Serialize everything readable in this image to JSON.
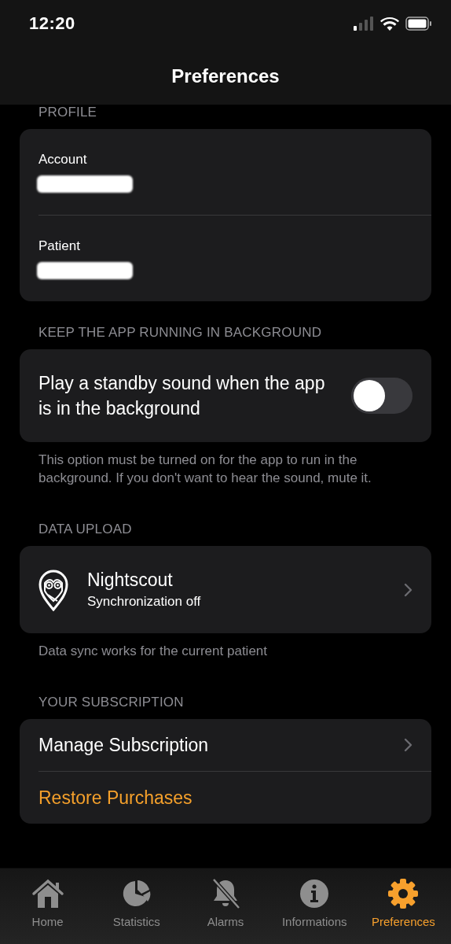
{
  "status_bar": {
    "time": "12:20"
  },
  "nav": {
    "title": "Preferences"
  },
  "sections": [
    {
      "header": "PROFILE",
      "rows": [
        {
          "kind": "field",
          "label": "Account",
          "redacted": true
        },
        {
          "kind": "field",
          "label": "Patient",
          "redacted": true
        }
      ]
    },
    {
      "header": "KEEP THE APP RUNNING IN BACKGROUND",
      "rows": [
        {
          "kind": "toggle",
          "label": "Play a standby sound when the app is in the background",
          "on": false
        }
      ],
      "footer": "This option must be turned on for the app to run in the background. If you don't want to hear the sound, mute it."
    },
    {
      "header": "DATA UPLOAD",
      "rows": [
        {
          "kind": "service",
          "title": "Nightscout",
          "subtitle": "Synchronization off"
        }
      ],
      "footer": "Data sync works for the current patient"
    },
    {
      "header": "YOUR SUBSCRIPTION",
      "rows": [
        {
          "kind": "link",
          "label": "Manage Subscription"
        },
        {
          "kind": "action",
          "label": "Restore Purchases"
        }
      ]
    }
  ],
  "tabs": [
    {
      "kind": "home",
      "label": "Home",
      "selected": false
    },
    {
      "kind": "stats",
      "label": "Statistics",
      "selected": false
    },
    {
      "kind": "alarms",
      "label": "Alarms",
      "selected": false
    },
    {
      "kind": "info",
      "label": "Informations",
      "selected": false
    },
    {
      "kind": "prefs",
      "label": "Preferences",
      "selected": true
    }
  ]
}
